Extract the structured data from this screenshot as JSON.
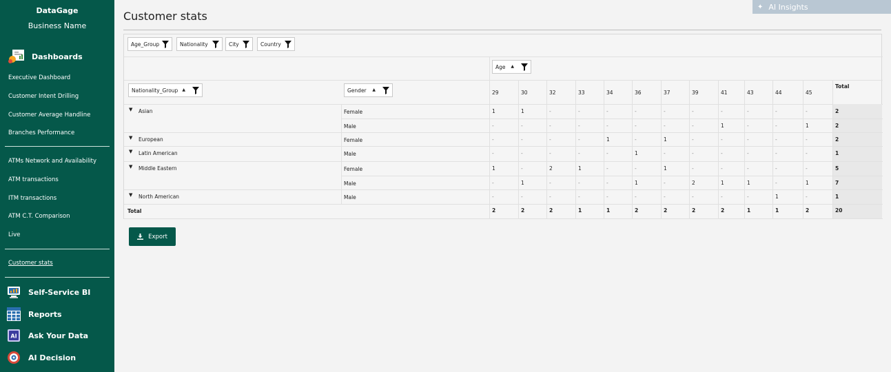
{
  "brand": {
    "app": "DataGage",
    "business": "Business Name"
  },
  "sidebar": {
    "dashboards_label": "Dashboards",
    "group1": [
      "Executive Dashboard",
      "Customer Intent Drilling",
      "Customer Average Handline",
      "Branches Performance"
    ],
    "group2": [
      "ATMs Network and Availability",
      "ATM transactions",
      "ITM transactions",
      "ATM C.T. Comparison",
      "Live"
    ],
    "group3": [
      "Customer stats"
    ],
    "bottom": [
      "Self-Service BI",
      "Reports",
      "Ask Your Data",
      "AI Decision"
    ]
  },
  "page": {
    "title": "Customer stats"
  },
  "ai_insights": {
    "label": "AI Insights"
  },
  "pivot": {
    "filters": [
      "Age_Group",
      "Nationality",
      "City",
      "Country"
    ],
    "col_field": "Age",
    "row_fields": [
      "Nationality_Group",
      "Gender"
    ],
    "ages": [
      "29",
      "30",
      "32",
      "33",
      "34",
      "36",
      "37",
      "39",
      "41",
      "43",
      "44",
      "45"
    ],
    "total_label": "Total",
    "groups": [
      "Asian",
      "European",
      "Latin American",
      "Middle Eastern",
      "North American"
    ],
    "rows": [
      {
        "gender": "Female",
        "cells": [
          "1",
          "1",
          "-",
          "-",
          "-",
          "-",
          "-",
          "-",
          "-",
          "-",
          "-",
          "-"
        ],
        "total": "2"
      },
      {
        "gender": "Male",
        "cells": [
          "-",
          "-",
          "-",
          "-",
          "-",
          "-",
          "-",
          "-",
          "1",
          "-",
          "-",
          "1"
        ],
        "total": "2"
      },
      {
        "gender": "Female",
        "cells": [
          "-",
          "-",
          "-",
          "-",
          "1",
          "-",
          "1",
          "-",
          "-",
          "-",
          "-",
          "-"
        ],
        "total": "2"
      },
      {
        "gender": "Male",
        "cells": [
          "-",
          "-",
          "-",
          "-",
          "-",
          "1",
          "-",
          "-",
          "-",
          "-",
          "-",
          "-"
        ],
        "total": "1"
      },
      {
        "gender": "Female",
        "cells": [
          "1",
          "-",
          "2",
          "1",
          "-",
          "-",
          "1",
          "-",
          "-",
          "-",
          "-",
          "-"
        ],
        "total": "5"
      },
      {
        "gender": "Male",
        "cells": [
          "-",
          "1",
          "-",
          "-",
          "-",
          "1",
          "-",
          "2",
          "1",
          "1",
          "-",
          "1"
        ],
        "total": "7"
      },
      {
        "gender": "Male",
        "cells": [
          "-",
          "-",
          "-",
          "-",
          "-",
          "-",
          "-",
          "-",
          "-",
          "-",
          "1",
          "-"
        ],
        "total": "1"
      }
    ],
    "col_totals": [
      "2",
      "2",
      "2",
      "1",
      "1",
      "2",
      "2",
      "2",
      "2",
      "1",
      "1",
      "2"
    ],
    "grand_total": "20"
  },
  "export": {
    "label": "Export"
  }
}
